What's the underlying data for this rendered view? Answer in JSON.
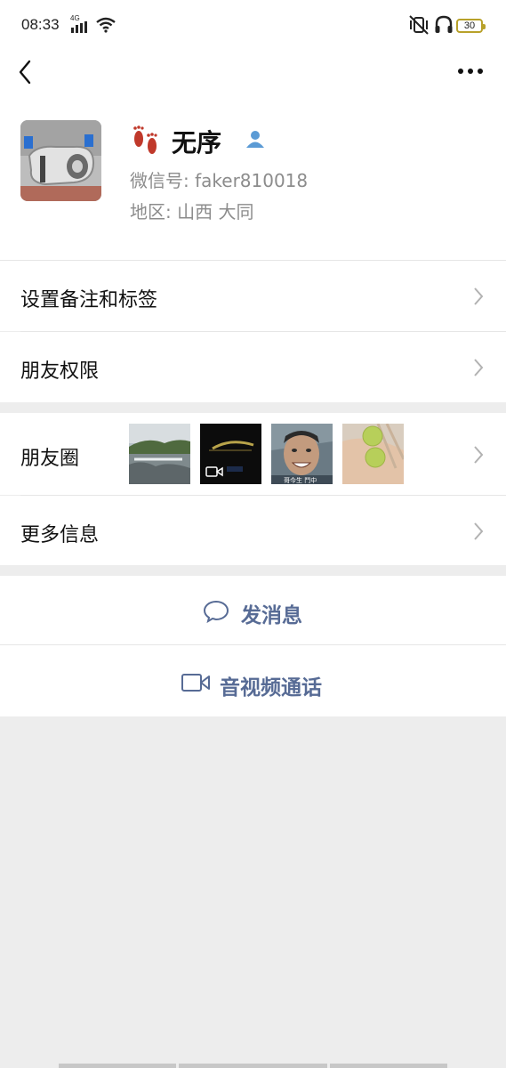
{
  "status_bar": {
    "time": "08:33",
    "network": "4G",
    "battery": "30",
    "icons": [
      "signal-icon",
      "wifi-icon",
      "vibrate-mute-icon",
      "headset-icon",
      "battery-icon"
    ]
  },
  "top_bar": {
    "back_icon": "back-arrow-icon",
    "more_icon": "more-dots-icon"
  },
  "profile": {
    "nickname": "无序",
    "wechat_id": "微信号: faker810018",
    "region": "地区: 山西  大同",
    "badge_icon": "contact-person-icon",
    "emoji_icon": "footprints-icon"
  },
  "rows": {
    "remark_tags": "设置备注和标签",
    "friend_permissions": "朋友权限",
    "moments": "朋友圈",
    "moments_thumb3_caption": "哥今生 鬥中",
    "more_info": "更多信息"
  },
  "actions": {
    "send_message": "发消息",
    "video_call": "音视频通话"
  },
  "colors": {
    "link_blue": "#576b95",
    "background": "#ededed"
  }
}
